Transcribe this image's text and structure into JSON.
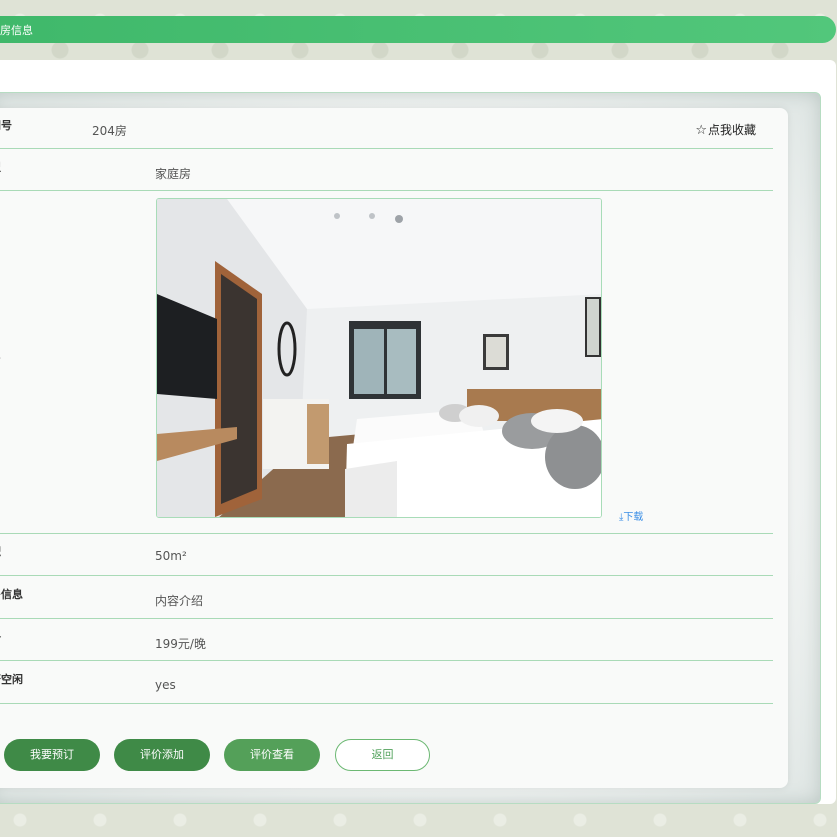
{
  "header": {
    "title": "房信息"
  },
  "details": {
    "room_no_label": "间号",
    "room_no_value": "204房",
    "favorite_label": "点我收藏",
    "type_label": "型",
    "type_value": "家庭房",
    "photo_label": "片",
    "download_label": "下载",
    "area_label": "积",
    "area_value": "50m²",
    "info_label": "房信息",
    "info_value": "内容介绍",
    "price_label": "格",
    "price_value": "199元/晚",
    "free_label": "否空闲",
    "free_value": "yes"
  },
  "actions": {
    "book": "我要预订",
    "review_add": "评价添加",
    "review_view": "评价查看",
    "back": "返回"
  },
  "colors": {
    "accent": "#3fb86a",
    "button_dark": "#3f8a47",
    "button_mid": "#54a059",
    "divider": "#a9dab7",
    "link": "#3a8ee6"
  },
  "icons": {
    "favorite": "star-outline-icon",
    "download": "download-icon"
  }
}
